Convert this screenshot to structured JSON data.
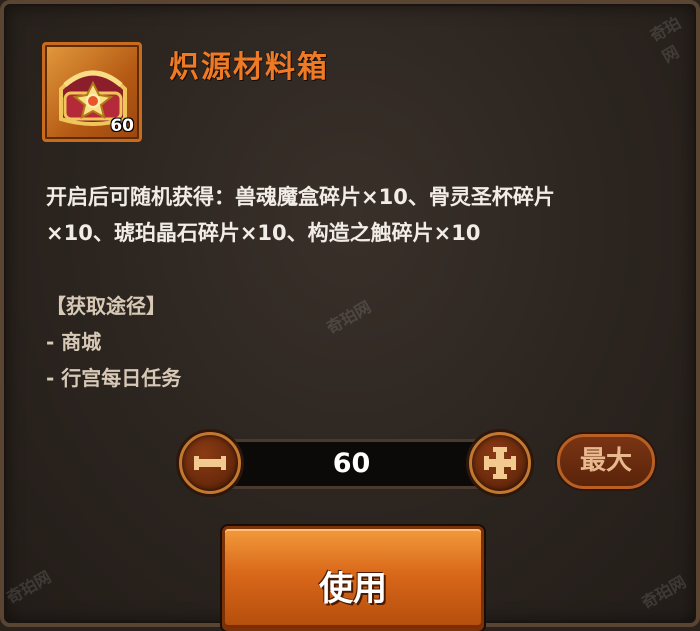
{
  "item": {
    "name": "炽源材料箱",
    "icon": "treasure-chest-icon",
    "count": "60"
  },
  "description": {
    "line1": "开启后可随机获得：兽魂魔盒碎片×10、骨灵圣杯碎片",
    "line2": "×10、琥珀晶石碎片×10、构造之触碎片×10"
  },
  "source": {
    "header": "【获取途径】",
    "items": [
      "- 商城",
      "- 行宫每日任务"
    ]
  },
  "quantity": {
    "value": "60",
    "minus_icon": "minus-icon",
    "plus_icon": "plus-icon",
    "max_label": "最大"
  },
  "use_label": "使用",
  "watermarks": [
    "奇珀网",
    "奇珀网",
    "奇珀网",
    "奇珀网"
  ],
  "colors": {
    "title": "#ef7a25",
    "accent": "#d9681a",
    "panel_bg": "#2b241f"
  }
}
